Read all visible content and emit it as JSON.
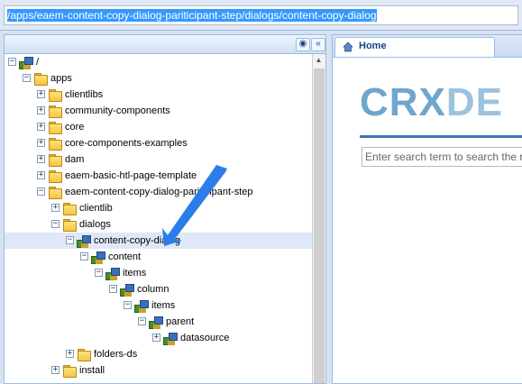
{
  "path": {
    "value": "/apps/eaem-content-copy-dialog-pariticipant-step/dialogs/content-copy-dialog"
  },
  "left_panel": {
    "buttons": [
      "binoculars-icon",
      "collapse-left-icon"
    ]
  },
  "tree": {
    "nodes": [
      {
        "label": "/",
        "icon": "node",
        "state": "expanded"
      },
      {
        "label": "apps",
        "icon": "folder",
        "state": "expanded"
      },
      {
        "label": "clientlibs",
        "icon": "folder",
        "state": "collapsed"
      },
      {
        "label": "community-components",
        "icon": "folder",
        "state": "collapsed"
      },
      {
        "label": "core",
        "icon": "folder",
        "state": "collapsed"
      },
      {
        "label": "core-components-examples",
        "icon": "folder",
        "state": "collapsed"
      },
      {
        "label": "dam",
        "icon": "folder",
        "state": "collapsed"
      },
      {
        "label": "eaem-basic-htl-page-template",
        "icon": "folder",
        "state": "collapsed"
      },
      {
        "label": "eaem-content-copy-dialog-pariticipant-step",
        "icon": "folder",
        "state": "expanded"
      },
      {
        "label": "clientlib",
        "icon": "folder",
        "state": "collapsed"
      },
      {
        "label": "dialogs",
        "icon": "folder",
        "state": "expanded"
      },
      {
        "label": "content-copy-dialog",
        "icon": "node",
        "state": "expanded",
        "selected": true
      },
      {
        "label": "content",
        "icon": "node",
        "state": "expanded"
      },
      {
        "label": "items",
        "icon": "node",
        "state": "expanded"
      },
      {
        "label": "column",
        "icon": "node",
        "state": "expanded"
      },
      {
        "label": "items",
        "icon": "node",
        "state": "expanded"
      },
      {
        "label": "parent",
        "icon": "node",
        "state": "expanded"
      },
      {
        "label": "datasource",
        "icon": "node",
        "state": "collapsed"
      },
      {
        "label": "folders-ds",
        "icon": "folder",
        "state": "collapsed"
      },
      {
        "label": "install",
        "icon": "folder",
        "state": "collapsed"
      }
    ]
  },
  "right_panel": {
    "tab": {
      "label": "Home",
      "icon": "home-icon"
    },
    "logo": {
      "bold": "CRX",
      "light": "DE"
    },
    "search_placeholder": "Enter search term to search the repository"
  },
  "colors": {
    "accent": "#3399ff",
    "arrow": "#2b7de9",
    "logo": "#6ea6cf"
  }
}
